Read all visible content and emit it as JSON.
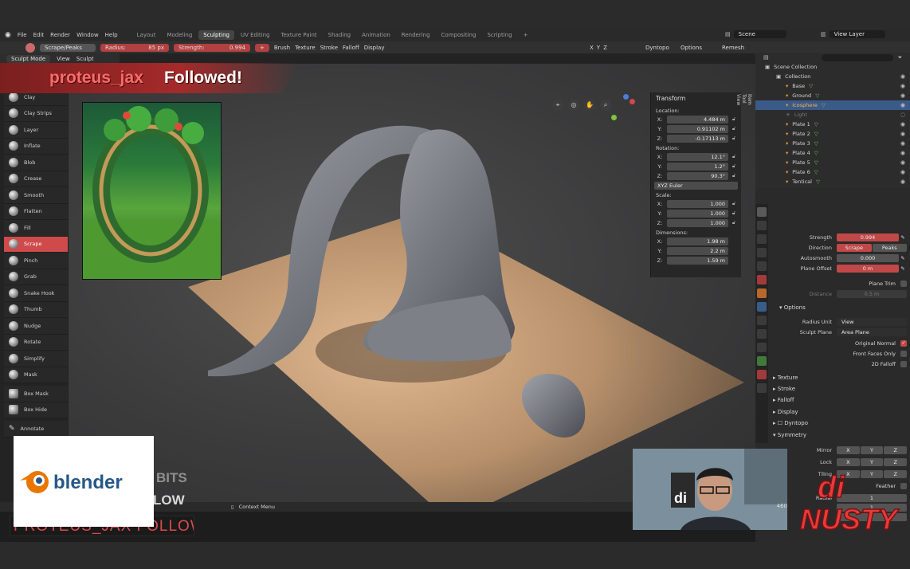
{
  "menu": {
    "file": "File",
    "edit": "Edit",
    "render": "Render",
    "window": "Window",
    "help": "Help"
  },
  "workspaces": [
    "Layout",
    "Modeling",
    "Sculpting",
    "UV Editing",
    "Texture Paint",
    "Shading",
    "Animation",
    "Rendering",
    "Compositing",
    "Scripting"
  ],
  "active_workspace_index": 2,
  "scene": {
    "scene_name": "Scene",
    "view_layer": "View Layer"
  },
  "tool_header": {
    "brush_name": "Scrape/Peaks",
    "radius_label": "Radius:",
    "radius_value": "85 px",
    "strength_label": "Strength:",
    "strength_value": "0.994",
    "brush": "Brush",
    "texture": "Texture",
    "stroke": "Stroke",
    "falloff": "Falloff",
    "display": "Display",
    "dyntopo": "Dyntopo",
    "options": "Options",
    "remesh": "Remesh",
    "axes": [
      "X",
      "Y",
      "Z"
    ]
  },
  "mode_bar": {
    "mode": "Sculpt Mode",
    "view": "View",
    "sculpt": "Sculpt"
  },
  "tools": [
    "Clay",
    "Clay Strips",
    "Layer",
    "Inflate",
    "Blob",
    "Crease",
    "Smooth",
    "Flatten",
    "Fill",
    "Scrape",
    "Pinch",
    "Grab",
    "Snake Hook",
    "Thumb",
    "Nudge",
    "Rotate",
    "Simplify",
    "Mask",
    "Box Mask",
    "Box Hide",
    "Annotate"
  ],
  "active_tool": "Scrape",
  "alert": {
    "username": "proteus_jax",
    "message": "Followed!"
  },
  "transform_panel": {
    "title": "Transform",
    "location_label": "Location:",
    "location": [
      {
        "axis": "X:",
        "value": "4.484 m"
      },
      {
        "axis": "Y:",
        "value": "0.91102 m"
      },
      {
        "axis": "Z:",
        "value": "-0.17113 m"
      }
    ],
    "rotation_label": "Rotation:",
    "rotation": [
      {
        "axis": "X:",
        "value": "12.1°"
      },
      {
        "axis": "Y:",
        "value": "1.2°"
      },
      {
        "axis": "Z:",
        "value": "90.3°"
      }
    ],
    "rotation_mode": "XYZ Euler",
    "scale_label": "Scale:",
    "scale": [
      {
        "axis": "X:",
        "value": "1.000"
      },
      {
        "axis": "Y:",
        "value": "1.000"
      },
      {
        "axis": "Z:",
        "value": "1.000"
      }
    ],
    "dimensions_label": "Dimensions:",
    "dimensions": [
      {
        "axis": "X:",
        "value": "1.98 m"
      },
      {
        "axis": "Y:",
        "value": "2.2 m"
      },
      {
        "axis": "Z:",
        "value": "1.59 m"
      }
    ],
    "side_tabs": [
      "Item",
      "Tool",
      "View"
    ]
  },
  "outliner": {
    "root": "Scene Collection",
    "collection": "Collection",
    "items": [
      "Base",
      "Ground",
      "Icosphere",
      "Light",
      "Plate 1",
      "Plate 2",
      "Plate 3",
      "Plate 4",
      "Plate 5",
      "Plate 6",
      "Tentical"
    ],
    "selected": "Icosphere"
  },
  "properties": {
    "strength_label": "Strength",
    "strength_value": "0.994",
    "direction_label": "Direction",
    "direction_a": "Scrape",
    "direction_b": "Peaks",
    "autosmooth_label": "Autosmooth",
    "autosmooth_value": "0.000",
    "plane_offset_label": "Plane Offset",
    "plane_offset_value": "0 m",
    "plane_trim_label": "Plane Trim",
    "distance_label": "Distance",
    "distance_value": "0.5 m",
    "options_label": "Options",
    "radius_unit_label": "Radius Unit",
    "radius_unit_value": "View",
    "sculpt_plane_label": "Sculpt Plane",
    "sculpt_plane_value": "Area Plane",
    "original_normal_label": "Original Normal",
    "front_faces_label": "Front Faces Only",
    "falloff_2d_label": "2D Falloff",
    "sections": [
      "Texture",
      "Stroke",
      "Falloff",
      "Display",
      "Dyntopo",
      "Symmetry"
    ],
    "mirror_label": "Mirror",
    "lock_label": "Lock",
    "tiling_label": "Tiling",
    "feather_label": "Feather",
    "radial_label": "Radial",
    "radial_values": [
      "1",
      "1",
      "1"
    ],
    "axes": [
      "X",
      "Y",
      "Z"
    ]
  },
  "status": {
    "context_menu": "Context Menu",
    "count": "460"
  },
  "overlays": {
    "bits": "BITS",
    "low": "LOW",
    "follow_banner": "PROTEUS_JAX FOLLOW",
    "blender_logo": "blender",
    "brand": "di nusty",
    "brand_line1": "di",
    "brand_line2": "NUSTY"
  },
  "colors": {
    "accent_red": "#c14848",
    "selection_blue": "#3a5a8a",
    "banner_red": "#a52a2a",
    "follow_red": "#ff6a6a"
  }
}
